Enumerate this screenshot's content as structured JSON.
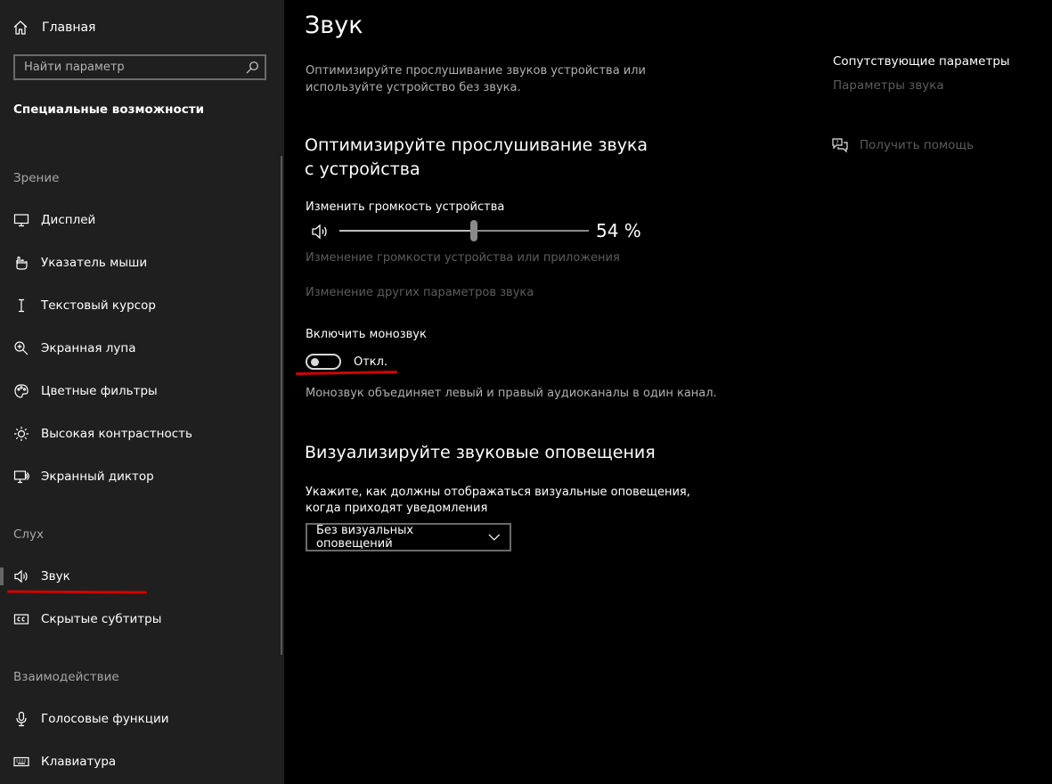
{
  "sidebar": {
    "home_label": "Главная",
    "search_placeholder": "Найти параметр",
    "section_title": "Специальные возможности",
    "groups": {
      "vision": "Зрение",
      "hearing": "Слух",
      "interaction": "Взаимодействие"
    },
    "items": [
      {
        "label": "Дисплей",
        "icon": "display-icon"
      },
      {
        "label": "Указатель мыши",
        "icon": "mouse-pointer-icon"
      },
      {
        "label": "Текстовый курсор",
        "icon": "text-cursor-icon"
      },
      {
        "label": "Экранная лупа",
        "icon": "magnifier-icon"
      },
      {
        "label": "Цветные фильтры",
        "icon": "color-filter-icon"
      },
      {
        "label": "Высокая контрастность",
        "icon": "high-contrast-icon"
      },
      {
        "label": "Экранный диктор",
        "icon": "narrator-icon"
      },
      {
        "label": "Звук",
        "icon": "speaker-icon",
        "active": true
      },
      {
        "label": "Скрытые субтитры",
        "icon": "closed-captions-icon"
      },
      {
        "label": "Голосовые функции",
        "icon": "microphone-icon"
      },
      {
        "label": "Клавиатура",
        "icon": "keyboard-icon"
      }
    ]
  },
  "main": {
    "title": "Звук",
    "description": "Оптимизируйте прослушивание звуков устройства или используйте устройство без звука.",
    "section1": {
      "heading": "Оптимизируйте прослушивание звука с устройства",
      "volume_label": "Изменить громкость устройства",
      "volume_percent": 54,
      "volume_value_text": "54 %",
      "link1": "Изменение громкости устройства или приложения",
      "link2": "Изменение других параметров звука",
      "mono_label": "Включить монозвук",
      "mono_state": "Откл.",
      "mono_on": false,
      "mono_description": "Монозвук объединяет левый и правый аудиоканалы в один канал."
    },
    "section2": {
      "heading": "Визуализируйте звуковые оповещения",
      "prompt": "Укажите, как должны отображаться визуальные оповещения, когда приходят уведомления",
      "dropdown_value": "Без визуальных оповещений"
    }
  },
  "related": {
    "title": "Сопутствующие параметры",
    "link": "Параметры звука",
    "help": "Получить помощь"
  },
  "colors": {
    "annotation_red": "#d30000"
  }
}
